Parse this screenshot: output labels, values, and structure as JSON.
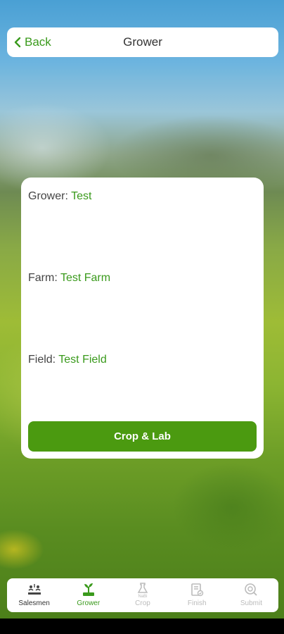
{
  "header": {
    "back_label": "Back",
    "title": "Grower"
  },
  "card": {
    "grower_label": "Grower:",
    "grower_value": "Test",
    "farm_label": "Farm:",
    "farm_value": "Test Farm",
    "field_label": "Field:",
    "field_value": "Test Field",
    "button_label": "Crop & Lab"
  },
  "tabs": [
    {
      "label": "Salesmen",
      "icon": "salesmen-icon",
      "state": "enabled"
    },
    {
      "label": "Grower",
      "icon": "grower-icon",
      "state": "active"
    },
    {
      "label": "Crop",
      "icon": "crop-icon",
      "state": "disabled"
    },
    {
      "label": "Finish",
      "icon": "finish-icon",
      "state": "disabled"
    },
    {
      "label": "Submit",
      "icon": "submit-icon",
      "state": "disabled"
    }
  ],
  "colors": {
    "accent": "#3a9a1c",
    "button": "#4b9a10",
    "disabled": "#bbbbbb"
  }
}
